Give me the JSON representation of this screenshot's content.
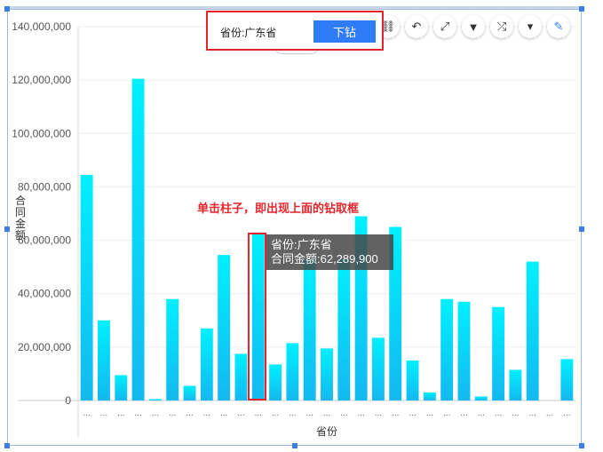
{
  "drill_popup": {
    "label": "省份:广东省",
    "button_label": "下钻"
  },
  "annotation": "单击柱子，即出现上面的钻取框",
  "tooltip": {
    "line1": "省份:广东省",
    "line2": "合同金额:62,289,900"
  },
  "toolbar": {
    "icons": [
      "unlink-icon",
      "undo-icon",
      "expand-icon",
      "filter-icon",
      "shuffle-icon",
      "dropdown-icon",
      "edit-icon"
    ]
  },
  "colors": {
    "bar_top": "#00f0ff",
    "bar_bottom": "#14b8f0",
    "accent": "#2f7cf6",
    "highlight": "#e1262c"
  },
  "chart_data": {
    "type": "bar",
    "xlabel": "省份",
    "ylabel": "合同金额",
    "ylim": [
      0,
      140000000
    ],
    "y_ticks": [
      "0",
      "20,000,000",
      "40,000,000",
      "60,000,000",
      "80,000,000",
      "100,000,000",
      "120,000,000",
      "140,000,000"
    ],
    "category_labels": [
      "...",
      "...",
      "...",
      "...",
      "...",
      "...",
      "...",
      "...",
      "...",
      "...",
      "...",
      "...",
      "...",
      "...",
      "...",
      "...",
      "...",
      "...",
      "...",
      "...",
      "...",
      "...",
      "...",
      "...",
      "...",
      "...",
      "...",
      "...",
      "...",
      "...",
      "..."
    ],
    "values": [
      84500000,
      30000000,
      9500000,
      120500000,
      500000,
      38000000,
      5500000,
      27000000,
      54500000,
      17500000,
      62289900,
      13500000,
      21500000,
      53000000,
      19500000,
      53000000,
      69000000,
      23500000,
      65000000,
      15000000,
      3000000,
      38000000,
      37000000,
      1500000,
      35000000,
      11500000,
      52000000,
      0,
      15500000
    ],
    "grid": true
  }
}
